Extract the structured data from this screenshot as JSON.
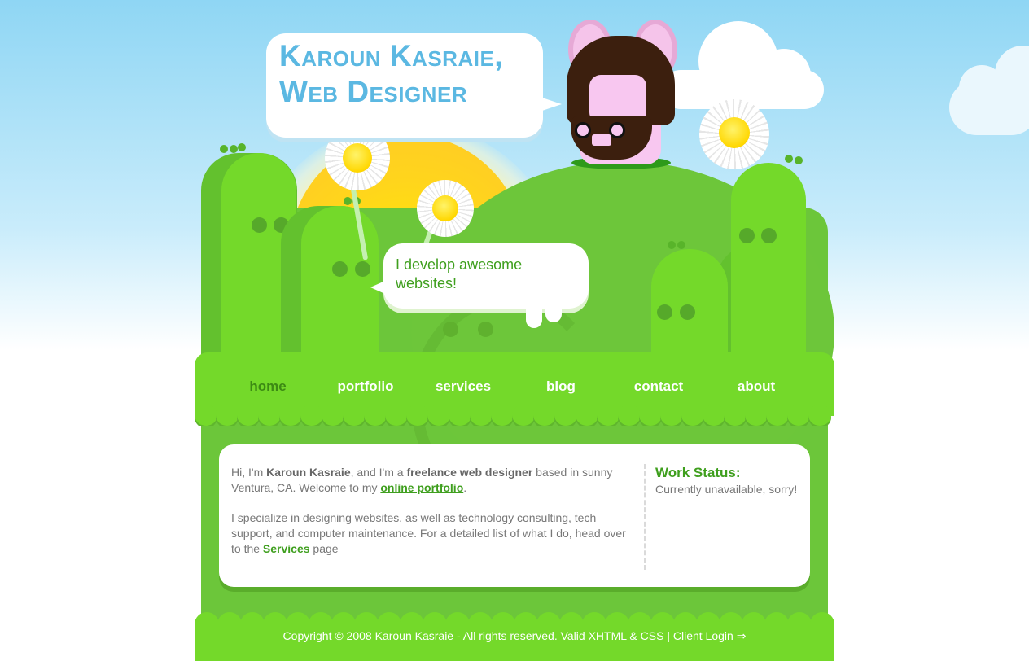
{
  "header": {
    "title_line1": "Karoun Kasraie,",
    "title_line2": "Web Designer",
    "tagline": "I develop awesome websites!"
  },
  "nav": {
    "items": [
      {
        "label": "home",
        "active": true
      },
      {
        "label": "portfolio",
        "active": false
      },
      {
        "label": "services",
        "active": false
      },
      {
        "label": "blog",
        "active": false
      },
      {
        "label": "contact",
        "active": false
      },
      {
        "label": "about",
        "active": false
      }
    ]
  },
  "intro": {
    "p1_a": "Hi, I'm ",
    "p1_name": "Karoun Kasraie",
    "p1_b": ", and I'm a ",
    "p1_role": "freelance web designer",
    "p1_c": " based in sunny Ventura, CA. Welcome to my ",
    "p1_link": "online portfolio",
    "p1_d": ".",
    "p2_a": "I specialize in designing websites, as well as technology consulting, tech support, and computer maintenance. For a detailed list of what I do, head over to the ",
    "p2_link": "Services",
    "p2_b": " page"
  },
  "work_status": {
    "title": "Work Status:",
    "text": "Currently unavailable, sorry!"
  },
  "footer": {
    "copyright": "Copyright © 2008 ",
    "name_link": "Karoun Kasraie",
    "rights": " - All rights reserved. Valid ",
    "xhtml_link": "XHTML",
    "amp": " & ",
    "css_link": "CSS",
    "sep": " | ",
    "client_link": "Client Login ⇒"
  },
  "colors": {
    "sky": "#8fd6f4",
    "grass": "#74d92a",
    "accent_green": "#3f9f1e",
    "title_blue": "#5bb8e2"
  }
}
